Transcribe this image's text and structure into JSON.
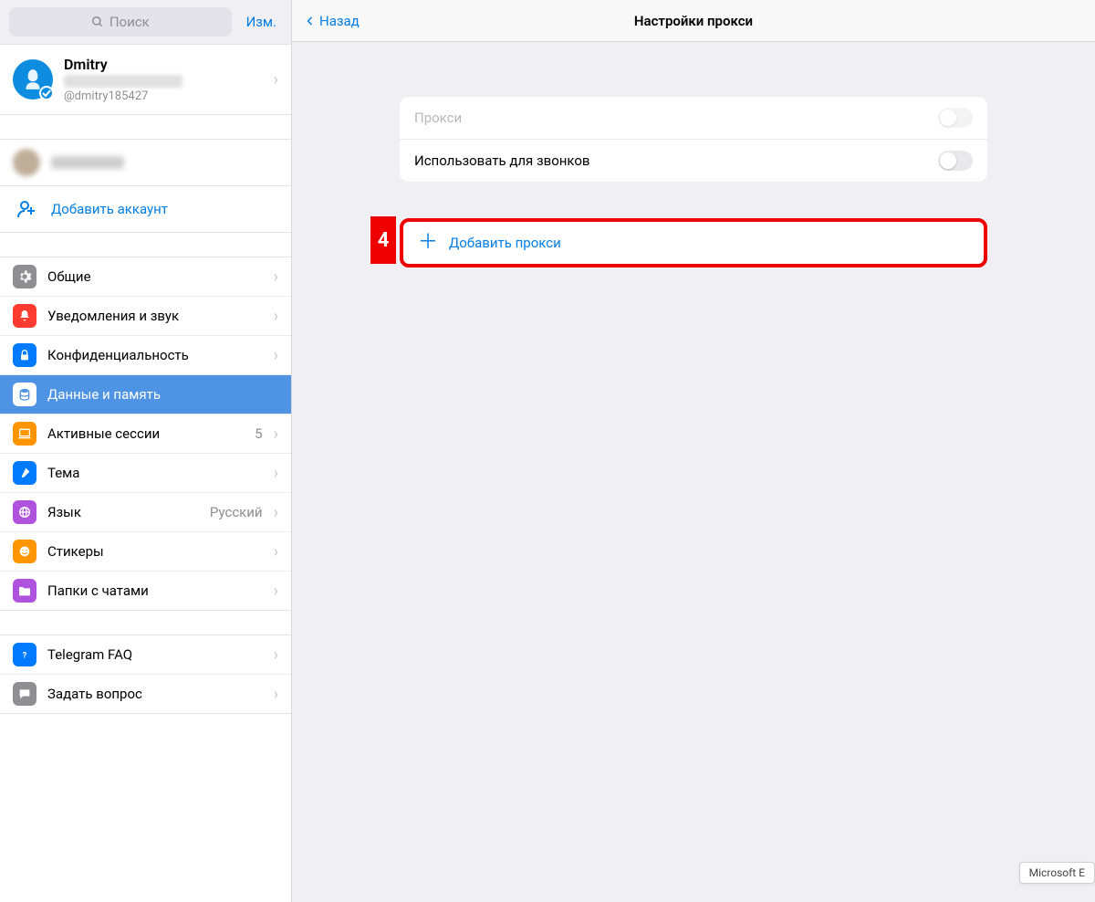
{
  "sidebar": {
    "search_placeholder": "Поиск",
    "edit": "Изм.",
    "profile": {
      "name": "Dmitry",
      "handle": "@dmitry185427"
    },
    "add_account": "Добавить аккаунт",
    "settings": [
      {
        "key": "general",
        "label": "Общие",
        "icon": "gear",
        "color": "ic-general"
      },
      {
        "key": "notif",
        "label": "Уведомления и звук",
        "icon": "bell",
        "color": "ic-notif"
      },
      {
        "key": "priv",
        "label": "Конфиденциальность",
        "icon": "lock",
        "color": "ic-priv"
      },
      {
        "key": "data",
        "label": "Данные и память",
        "icon": "db",
        "color": "ic-data",
        "active": true
      },
      {
        "key": "sess",
        "label": "Активные сессии",
        "icon": "laptop",
        "color": "ic-sess",
        "value": "5"
      },
      {
        "key": "theme",
        "label": "Тема",
        "icon": "brush",
        "color": "ic-theme"
      },
      {
        "key": "lang",
        "label": "Язык",
        "icon": "globe",
        "color": "ic-lang",
        "value": "Русский"
      },
      {
        "key": "stick",
        "label": "Стикеры",
        "icon": "sticker",
        "color": "ic-stick"
      },
      {
        "key": "fold",
        "label": "Папки с чатами",
        "icon": "folder",
        "color": "ic-fold"
      }
    ],
    "help": [
      {
        "key": "faq",
        "label": "Telegram FAQ",
        "icon": "question",
        "color": "ic-faq"
      },
      {
        "key": "ask",
        "label": "Задать вопрос",
        "icon": "chat",
        "color": "ic-ask"
      }
    ]
  },
  "content": {
    "back": "Назад",
    "title": "Настройки прокси",
    "proxy_label": "Прокси",
    "calls_label": "Использовать для звонков",
    "add_proxy": "Добавить прокси",
    "callout_number": "4"
  },
  "tooltip": "Microsoft E"
}
